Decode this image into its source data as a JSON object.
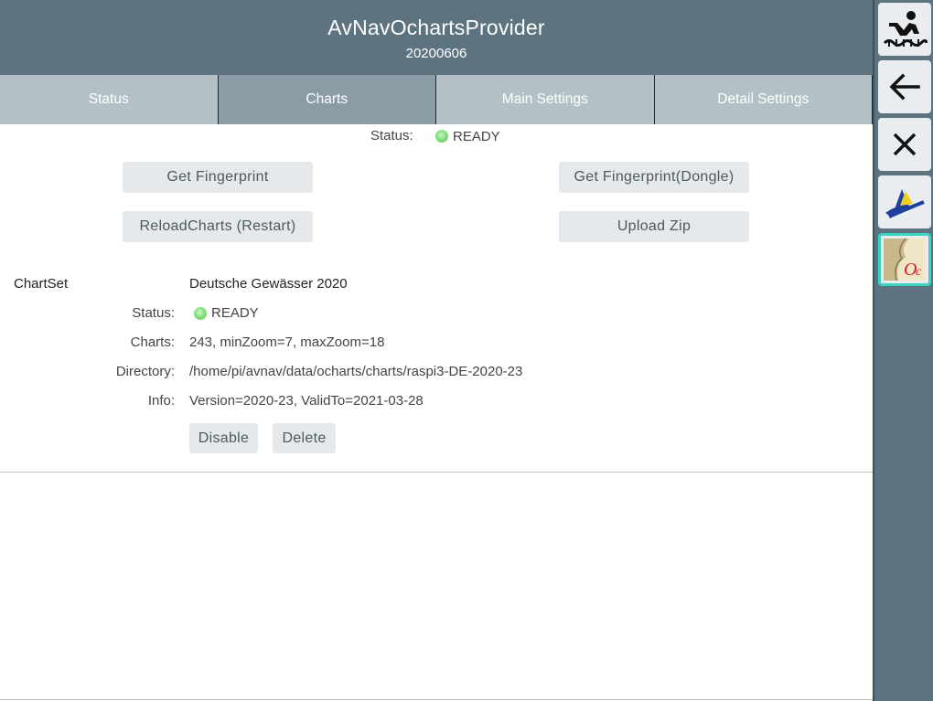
{
  "header": {
    "title": "AvNavOchartsProvider",
    "version": "20200606"
  },
  "tabs": [
    {
      "label": "Status",
      "active": false
    },
    {
      "label": "Charts",
      "active": true
    },
    {
      "label": "Main Settings",
      "active": false
    },
    {
      "label": "Detail Settings",
      "active": false
    }
  ],
  "status": {
    "label": "Status:",
    "value": "READY",
    "indicator_color": "#79dd75"
  },
  "buttons": {
    "get_fingerprint": "Get Fingerprint",
    "get_fingerprint_dongle": "Get Fingerprint(Dongle)",
    "reload_charts": "ReloadCharts (Restart)",
    "upload_zip": "Upload Zip"
  },
  "chartset": {
    "heading": "ChartSet",
    "name": "Deutsche Gewässer 2020",
    "status_label": "Status:",
    "status_value": "READY",
    "charts_label": "Charts:",
    "charts_value": "243, minZoom=7, maxZoom=18",
    "directory_label": "Directory:",
    "directory_value": "/home/pi/avnav/data/ocharts/charts/raspi3-DE-2020-23",
    "info_label": "Info:",
    "info_value": "Version=2020-23, ValidTo=2021-03-28",
    "disable_label": "Disable",
    "delete_label": "Delete"
  },
  "side_buttons": [
    {
      "icon": "anchor-watch-icon"
    },
    {
      "icon": "back-arrow-icon"
    },
    {
      "icon": "close-icon"
    },
    {
      "icon": "avnav-logo-icon"
    },
    {
      "icon": "ocharts-logo-icon",
      "active": true
    }
  ],
  "colors": {
    "header_bg": "#5d7480",
    "tab_bg": "#b3c0c6",
    "tab_active_bg": "#8a9da7",
    "button_bg": "#e5e9eb",
    "active_border": "#38d6c0"
  }
}
